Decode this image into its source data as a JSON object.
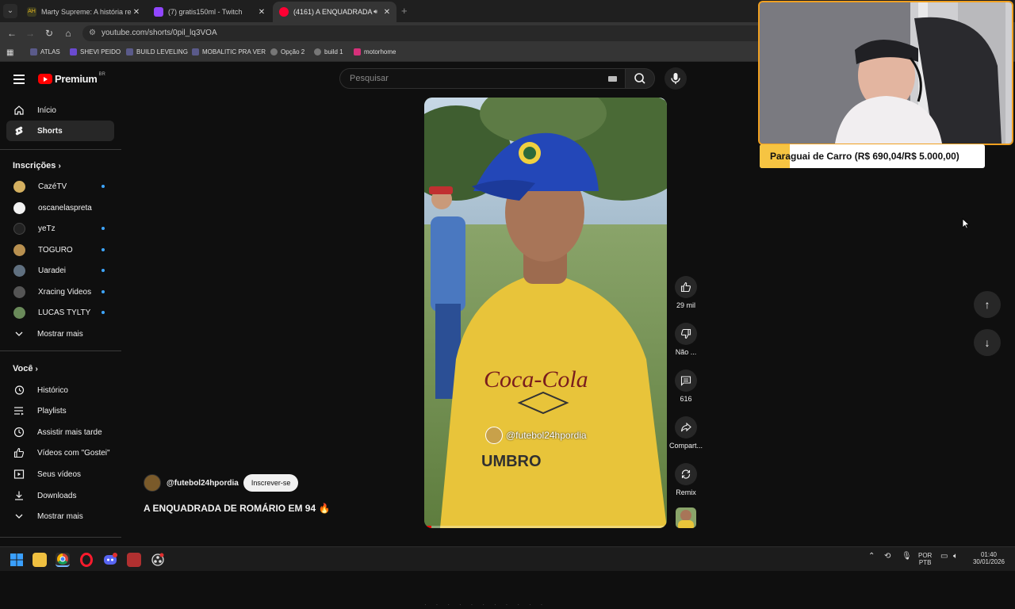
{
  "browser": {
    "tabs": [
      {
        "title": "Marty Supreme: A história real d",
        "favicon": "AH",
        "color": "#e0b020",
        "active": false
      },
      {
        "title": "(7) gratis150ml - Twitch",
        "favicon": "tw",
        "color": "#9146ff",
        "active": false
      },
      {
        "title": "(4161) A ENQUADRADA DE",
        "favicon": "yt",
        "color": "#ff0033",
        "active": true
      }
    ],
    "url": "youtube.com/shorts/0pil_lq3VOA",
    "bookmarks": [
      "ATLAS",
      "SHEVI PEIDO",
      "BUILD LEVELING",
      "MOBALITIC PRA VER",
      "Opção 2",
      "build 1",
      "motorhome"
    ]
  },
  "youtube": {
    "logo_text": "Premium",
    "logo_region": "BR",
    "search_placeholder": "Pesquisar",
    "nav": [
      {
        "label": "Início",
        "icon": "home-icon"
      },
      {
        "label": "Shorts",
        "icon": "shorts-icon",
        "selected": true
      }
    ],
    "subscriptions_header": "Inscrições",
    "subscriptions": [
      {
        "label": "CazéTV",
        "dot": true,
        "color": "#d4b060"
      },
      {
        "label": "oscanelaspreta",
        "dot": false,
        "color": "#f2f2f2"
      },
      {
        "label": "yeTz",
        "dot": true,
        "color": "#222"
      },
      {
        "label": "TOGURO",
        "dot": true,
        "color": "#b89050"
      },
      {
        "label": "Uaradei",
        "dot": true,
        "color": "#607080"
      },
      {
        "label": "Xracing Videos",
        "dot": true,
        "color": "#555"
      },
      {
        "label": "LUCAS TYLTY",
        "dot": true,
        "color": "#6a8a5a"
      }
    ],
    "show_more": "Mostrar mais",
    "you_header": "Você",
    "you_items": [
      {
        "label": "Histórico",
        "icon": "history-icon"
      },
      {
        "label": "Playlists",
        "icon": "playlists-icon"
      },
      {
        "label": "Assistir mais tarde",
        "icon": "watch-later-icon"
      },
      {
        "label": "Vídeos com \"Gostei\"",
        "icon": "liked-videos-icon"
      },
      {
        "label": "Seus vídeos",
        "icon": "your-videos-icon"
      },
      {
        "label": "Downloads",
        "icon": "downloads-icon"
      }
    ],
    "you_show_more": "Mostrar mais",
    "short": {
      "channel": "@futebol24hpordia",
      "subscribe": "Inscrever-se",
      "title": "A ENQUADRADA DE ROMÁRIO EM 94 🔥",
      "watermark": "@futebol24hpordia",
      "progress": 0.03,
      "actions": {
        "likes": "29 mil",
        "dislike": "Não ...",
        "comments": "616",
        "share": "Compart...",
        "remix": "Remix"
      }
    }
  },
  "stream_overlay": {
    "caption": "Paraguai de Carro (R$ 690,04/R$ 5.000,00)"
  },
  "taskbar": {
    "lang_top": "POR",
    "lang_bottom": "PTB",
    "time": "01:40",
    "date": "30/01/2026"
  }
}
